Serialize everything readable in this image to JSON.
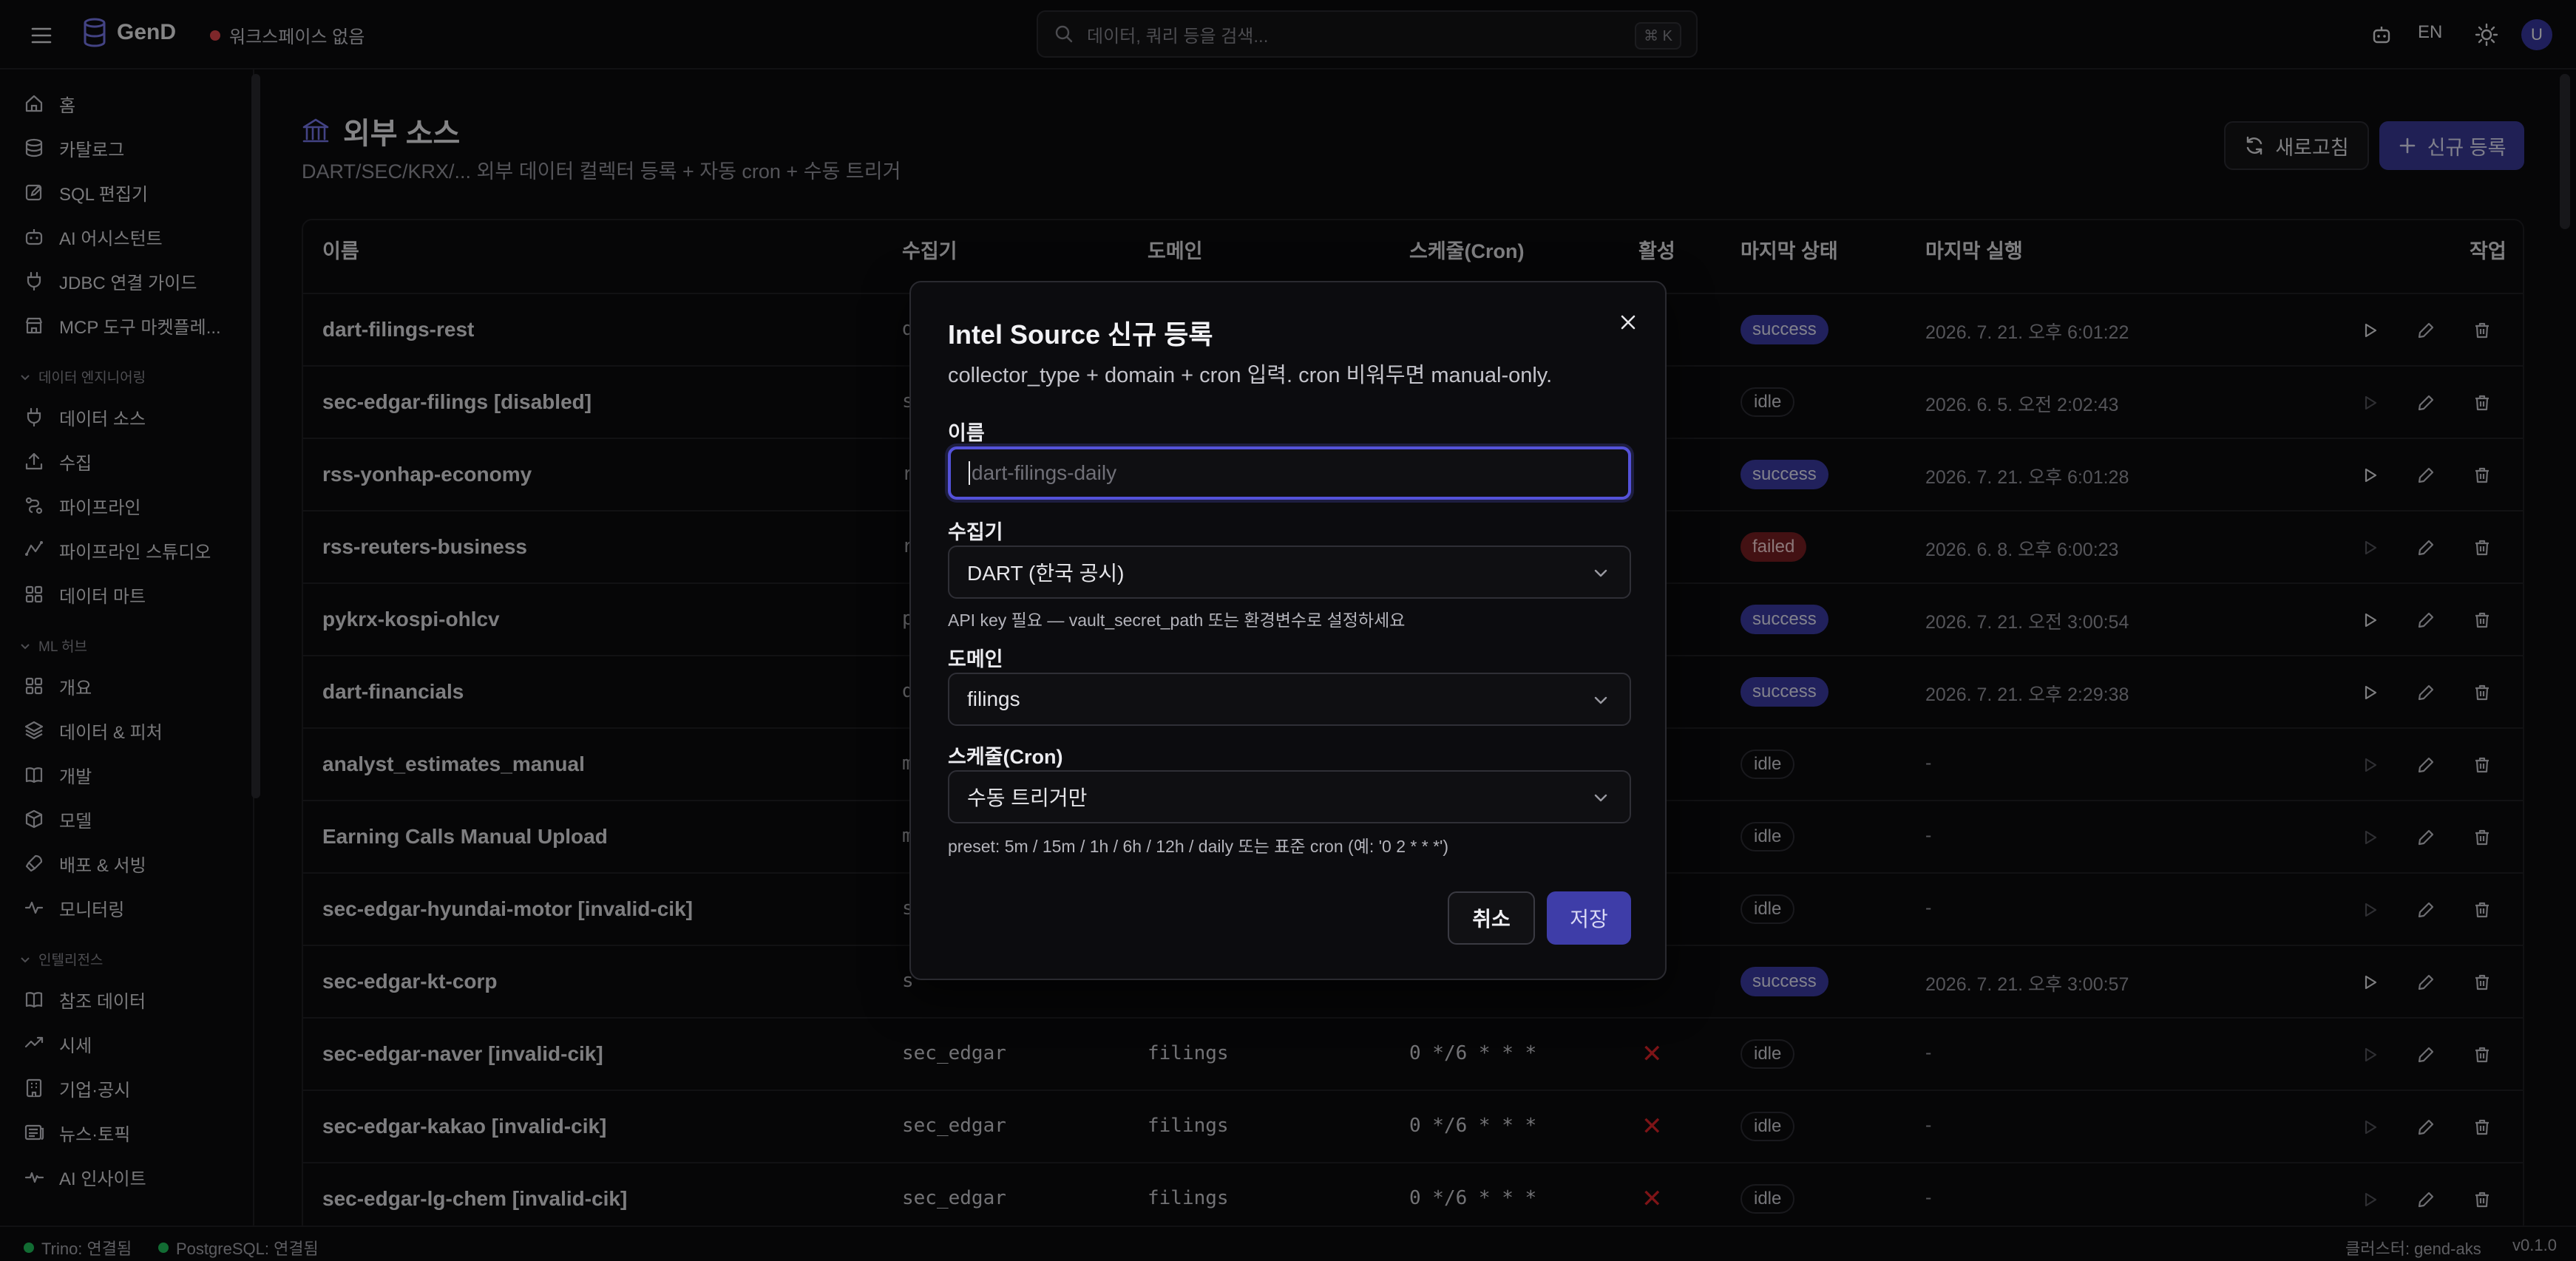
{
  "app": {
    "name": "GenD",
    "workspace": "워크스페이스 없음",
    "status_color": "#e5484d",
    "accent": "#3d3ca8"
  },
  "search": {
    "placeholder": "데이터, 쿼리 등을 검색...",
    "shortcut": "⌘ K"
  },
  "header": {
    "language": "EN",
    "avatar": "U"
  },
  "sidebar": {
    "items_top": [
      {
        "label": "홈",
        "icon": "home-icon"
      },
      {
        "label": "카탈로그",
        "icon": "database-icon"
      },
      {
        "label": "SQL 편집기",
        "icon": "edit-icon"
      },
      {
        "label": "AI 어시스턴트",
        "icon": "bot-icon"
      },
      {
        "label": "JDBC 연결 가이드",
        "icon": "plug-icon"
      },
      {
        "label": "MCP 도구 마켓플레...",
        "icon": "store-icon"
      }
    ],
    "section_de": "데이터 엔지니어링",
    "items_de": [
      {
        "label": "데이터 소스",
        "icon": "plug-icon"
      },
      {
        "label": "수집",
        "icon": "upload-icon"
      },
      {
        "label": "파이프라인",
        "icon": "pipeline-icon"
      },
      {
        "label": "파이프라인 스튜디오",
        "icon": "studio-icon"
      },
      {
        "label": "데이터 마트",
        "icon": "grid-icon"
      }
    ],
    "section_ml": "ML 허브",
    "items_ml": [
      {
        "label": "개요",
        "icon": "grid-icon"
      },
      {
        "label": "데이터 & 피처",
        "icon": "layers-icon"
      },
      {
        "label": "개발",
        "icon": "book-icon"
      },
      {
        "label": "모델",
        "icon": "box-icon"
      },
      {
        "label": "배포 & 서빙",
        "icon": "rocket-icon"
      },
      {
        "label": "모니터링",
        "icon": "activity-icon"
      }
    ],
    "section_intel": "인텔리전스",
    "items_intel": [
      {
        "label": "참조 데이터",
        "icon": "book-icon"
      },
      {
        "label": "시세",
        "icon": "trend-icon"
      },
      {
        "label": "기업·공시",
        "icon": "building-icon"
      },
      {
        "label": "뉴스·토픽",
        "icon": "news-icon"
      },
      {
        "label": "AI 인사이트",
        "icon": "pulse-icon"
      }
    ]
  },
  "page": {
    "title": "외부 소스",
    "subtitle": "DART/SEC/KRX/... 외부 데이터 컬렉터 등록 + 자동 cron + 수동 트리거",
    "refresh_label": "새로고침",
    "new_label": "신규 등록"
  },
  "table": {
    "columns": [
      "이름",
      "수집기",
      "도메인",
      "스케줄(Cron)",
      "활성",
      "마지막 상태",
      "마지막 실행",
      "작업"
    ],
    "rows": [
      {
        "name": "dart-filings-rest",
        "collector": "d",
        "domain": "",
        "cron": "",
        "status": "success",
        "last_run": "2026. 7. 21. 오후 6:01:22"
      },
      {
        "name": "sec-edgar-filings [disabled]",
        "collector": "s",
        "domain": "",
        "cron": "",
        "status": "idle",
        "last_run": "2026. 6. 5. 오전 2:02:43"
      },
      {
        "name": "rss-yonhap-economy",
        "collector": "r",
        "domain": "",
        "cron": "",
        "status": "success",
        "last_run": "2026. 7. 21. 오후 6:01:28"
      },
      {
        "name": "rss-reuters-business",
        "collector": "r",
        "domain": "",
        "cron": "",
        "status": "failed",
        "last_run": "2026. 6. 8. 오후 6:00:23"
      },
      {
        "name": "pykrx-kospi-ohlcv",
        "collector": "p",
        "domain": "",
        "cron": "",
        "status": "success",
        "last_run": "2026. 7. 21. 오전 3:00:54"
      },
      {
        "name": "dart-financials",
        "collector": "d",
        "domain": "",
        "cron": "",
        "status": "success",
        "last_run": "2026. 7. 21. 오후 2:29:38"
      },
      {
        "name": "analyst_estimates_manual",
        "collector": "m",
        "domain": "",
        "cron": "",
        "status": "idle",
        "last_run": "-"
      },
      {
        "name": "Earning Calls Manual Upload",
        "collector": "m",
        "domain": "",
        "cron": "",
        "status": "idle",
        "last_run": "-"
      },
      {
        "name": "sec-edgar-hyundai-motor [invalid-cik]",
        "collector": "s",
        "domain": "",
        "cron": "",
        "status": "idle",
        "last_run": "-"
      },
      {
        "name": "sec-edgar-kt-corp",
        "collector": "s",
        "domain": "",
        "cron": "",
        "status": "success",
        "last_run": "2026. 7. 21. 오후 3:00:57"
      },
      {
        "name": "sec-edgar-naver [invalid-cik]",
        "collector": "sec_edgar",
        "domain": "filings",
        "cron": "0 */6 * * *",
        "active": "✕",
        "status": "idle",
        "last_run": "-"
      },
      {
        "name": "sec-edgar-kakao [invalid-cik]",
        "collector": "sec_edgar",
        "domain": "filings",
        "cron": "0 */6 * * *",
        "active": "✕",
        "status": "idle",
        "last_run": "-"
      },
      {
        "name": "sec-edgar-lg-chem [invalid-cik]",
        "collector": "sec_edgar",
        "domain": "filings",
        "cron": "0 */6 * * *",
        "active": "✕",
        "status": "idle",
        "last_run": "-"
      }
    ]
  },
  "modal": {
    "title": "Intel Source 신규 등록",
    "description": "collector_type + domain + cron 입력. cron 비워두면 manual-only.",
    "name_label": "이름",
    "name_placeholder": "dart-filings-daily",
    "collector_label": "수집기",
    "collector_value": "DART (한국 공시)",
    "collector_help": "API key 필요 — vault_secret_path 또는 환경변수로 설정하세요",
    "domain_label": "도메인",
    "domain_value": "filings",
    "schedule_label": "스케줄(Cron)",
    "schedule_value": "수동 트리거만",
    "schedule_help": "preset: 5m / 15m / 1h / 6h / 12h / daily 또는 표준 cron (예: '0 2 * * *')",
    "cancel_label": "취소",
    "save_label": "저장"
  },
  "statusbar": {
    "trino": "Trino: 연결됨",
    "postgres": "PostgreSQL: 연결됨",
    "cluster": "클러스터: gend-aks",
    "version": "v0.1.0"
  }
}
